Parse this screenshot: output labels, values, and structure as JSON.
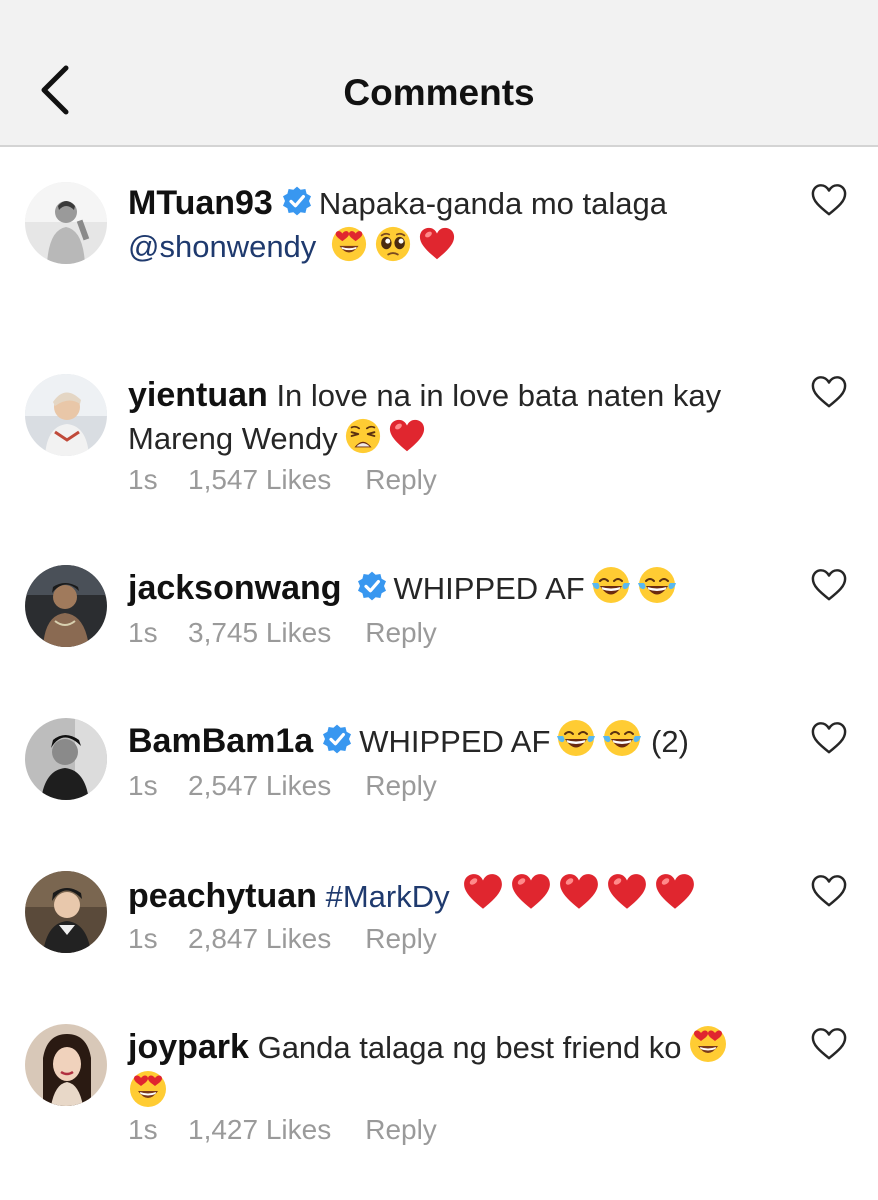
{
  "header": {
    "title": "Comments"
  },
  "comments": [
    {
      "username": "MTuan93",
      "verified": true,
      "text": "Napaka-ganda mo talaga",
      "mention": "@shonwendy",
      "emojis": [
        "heart-eyes",
        "pleading",
        "red-heart"
      ]
    },
    {
      "username": "yientuan",
      "verified": false,
      "text": "In love na in love bata naten kay Mareng Wendy",
      "emojis": [
        "weary",
        "red-heart"
      ],
      "time": "1s",
      "likes": "1,547 Likes",
      "reply": "Reply"
    },
    {
      "username": "jacksonwang",
      "verified": true,
      "text": "WHIPPED AF",
      "emojis": [
        "tears-of-joy",
        "tears-of-joy"
      ],
      "time": "1s",
      "likes": "3,745 Likes",
      "reply": "Reply"
    },
    {
      "username": "BamBam1a",
      "verified": true,
      "text": "WHIPPED AF",
      "emojis": [
        "tears-of-joy",
        "tears-of-joy"
      ],
      "suffix": "(2)",
      "time": "1s",
      "likes": "2,547 Likes",
      "reply": "Reply"
    },
    {
      "username": "peachytuan",
      "verified": false,
      "hashtag": "#MarkDy",
      "emojis": [
        "red-heart",
        "red-heart",
        "red-heart",
        "red-heart",
        "red-heart"
      ],
      "time": "1s",
      "likes": "2,847 Likes",
      "reply": "Reply"
    },
    {
      "username": "joypark",
      "verified": false,
      "text": "Ganda talaga ng best friend ko",
      "emojis": [
        "heart-eyes",
        "heart-eyes"
      ],
      "time": "1s",
      "likes": "1,427 Likes",
      "reply": "Reply"
    }
  ],
  "icons": {
    "back": "chevron-left-icon",
    "verified": "verified-badge-icon",
    "like": "heart-outline-icon"
  },
  "colors": {
    "header_bg": "#f2f2f2",
    "verified_blue": "#3897f0",
    "link_blue": "#1f3a6e",
    "meta_gray": "#9a9a9a",
    "emoji_heart_red": "#e0262f"
  }
}
